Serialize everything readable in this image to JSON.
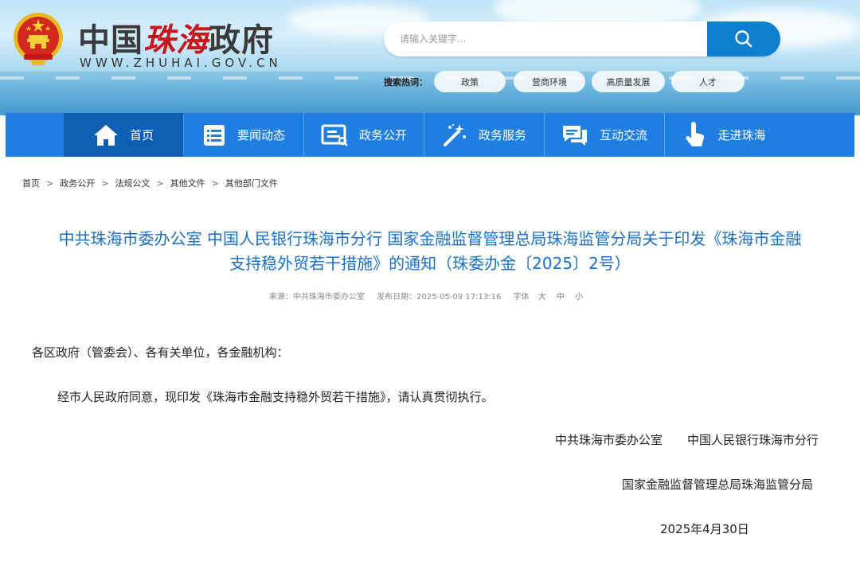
{
  "header": {
    "site_name_prefix": "中国",
    "site_name_city": "珠海",
    "site_name_suffix": "政府",
    "site_domain": "WWW.ZHUHAI.GOV.CN",
    "search": {
      "placeholder": "请输入关键字..."
    },
    "hot_label": "搜索热词：",
    "hot_tags": [
      "政策",
      "营商环境",
      "高质量发展",
      "人才"
    ]
  },
  "nav": {
    "items": [
      {
        "label": "首页",
        "icon": "home-icon"
      },
      {
        "label": "要闻动态",
        "icon": "news-list-icon"
      },
      {
        "label": "政务公开",
        "icon": "document-icon"
      },
      {
        "label": "政务服务",
        "icon": "magic-wand-icon"
      },
      {
        "label": "互动交流",
        "icon": "chat-icon"
      },
      {
        "label": "走进珠海",
        "icon": "hand-pointer-icon"
      }
    ]
  },
  "breadcrumb": [
    "首页",
    "政务公开",
    "法规公文",
    "其他文件",
    "其他部门文件"
  ],
  "article": {
    "title_line1": "中共珠海市委办公室 中国人民银行珠海市分行 国家金融监督管理总局珠海监管分局关于印发《珠海市金融",
    "title_line2": "支持稳外贸若干措施》的通知（珠委办金〔2025〕2号）",
    "meta": {
      "source_label": "来源：",
      "source": "中共珠海市委办公室",
      "date_label": "发布日期：",
      "date": "2025-05-09 17:13:16",
      "font_label": "字体",
      "font_large": "大",
      "font_medium": "中",
      "font_small": "小"
    },
    "salutation": "各区政府（管委会）、各有关单位，各金融机构：",
    "body": "经市人民政府同意，现印发《珠海市金融支持稳外贸若干措施》，请认真贯彻执行。",
    "signer1": "中共珠海市委办公室",
    "signer2": "中国人民银行珠海市分行",
    "signer3": "国家金融监督管理总局珠海监管分局",
    "sign_date": "2025年4月30日"
  },
  "colors": {
    "nav_bg": "#1e7fe0",
    "nav_active": "#0c5fb3",
    "title_blue": "#1a6fc7",
    "search_btn": "#0f7fd0",
    "brand_red": "#c8161d"
  }
}
